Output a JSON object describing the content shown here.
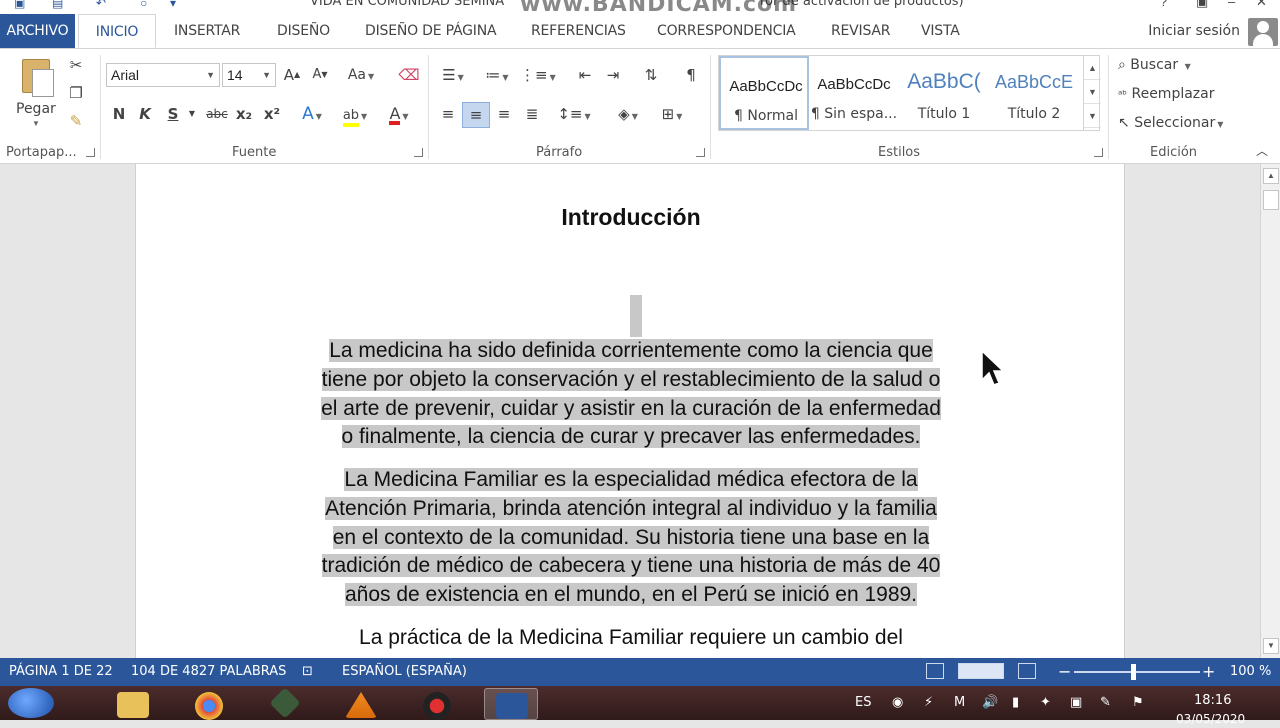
{
  "window": {
    "title_left": "VIDA EN COMUNIDAD SEMINA",
    "title_right": "ror de activación de productos)",
    "watermark": "www.BANDICAM.com"
  },
  "tabs": {
    "file": "ARCHIVO",
    "items": [
      "INICIO",
      "INSERTAR",
      "DISEÑO",
      "DISEÑO DE PÁGINA",
      "REFERENCIAS",
      "CORRESPONDENCIA",
      "REVISAR",
      "VISTA"
    ],
    "signin": "Iniciar sesión"
  },
  "ribbon": {
    "clipboard": {
      "paste_label": "Pegar",
      "group": "Portapap..."
    },
    "font": {
      "name": "Arial",
      "size": "14",
      "case_label": "Aa",
      "group": "Fuente",
      "bold": "N",
      "italic": "K",
      "underline": "S",
      "strike": "abc",
      "sub": "x₂",
      "sup": "x²"
    },
    "paragraph": {
      "group": "Párrafo"
    },
    "styles": {
      "group": "Estilos",
      "items": [
        {
          "sample": "AaBbCcDc",
          "name": "¶ Normal"
        },
        {
          "sample": "AaBbCcDc",
          "name": "¶ Sin espa..."
        },
        {
          "sample": "AaBbC(",
          "name": "Título 1"
        },
        {
          "sample": "AaBbCcE",
          "name": "Título 2"
        }
      ]
    },
    "editing": {
      "group": "Edición",
      "find": "Buscar",
      "replace": "Reemplazar",
      "select": "Seleccionar"
    }
  },
  "document": {
    "title": "Introducción",
    "para1": [
      "La medicina ha sido definida corrientemente como la ciencia que",
      "tiene por objeto la conservación y el restablecimiento de la salud o",
      "el arte de prevenir, cuidar y asistir en la curación de la enfermedad",
      "o finalmente, la ciencia de curar y precaver las enfermedades."
    ],
    "para2": [
      "La Medicina Familiar es la especialidad médica efectora de la",
      "Atención Primaria, brinda atención integral al individuo y la familia",
      "en el contexto de la comunidad. Su historia tiene una base en la",
      "tradición de médico de cabecera y tiene una historia de más de 40",
      "años de existencia en el mundo, en el Perú se inició en 1989."
    ],
    "para3": [
      "La práctica de la Medicina Familiar requiere un cambio del"
    ]
  },
  "status": {
    "page": "PÁGINA 1 DE 22",
    "words": "104 DE 4827 PALABRAS",
    "language": "ESPAÑOL (ESPAÑA)",
    "zoom": "100 %",
    "zoom_value": 100
  },
  "taskbar": {
    "lang": "ES",
    "time": "18:16",
    "date": "03/05/2020"
  },
  "colors": {
    "accent": "#2b579a",
    "highlight": "#c8c8c8",
    "taskbar": "#3d2020"
  }
}
